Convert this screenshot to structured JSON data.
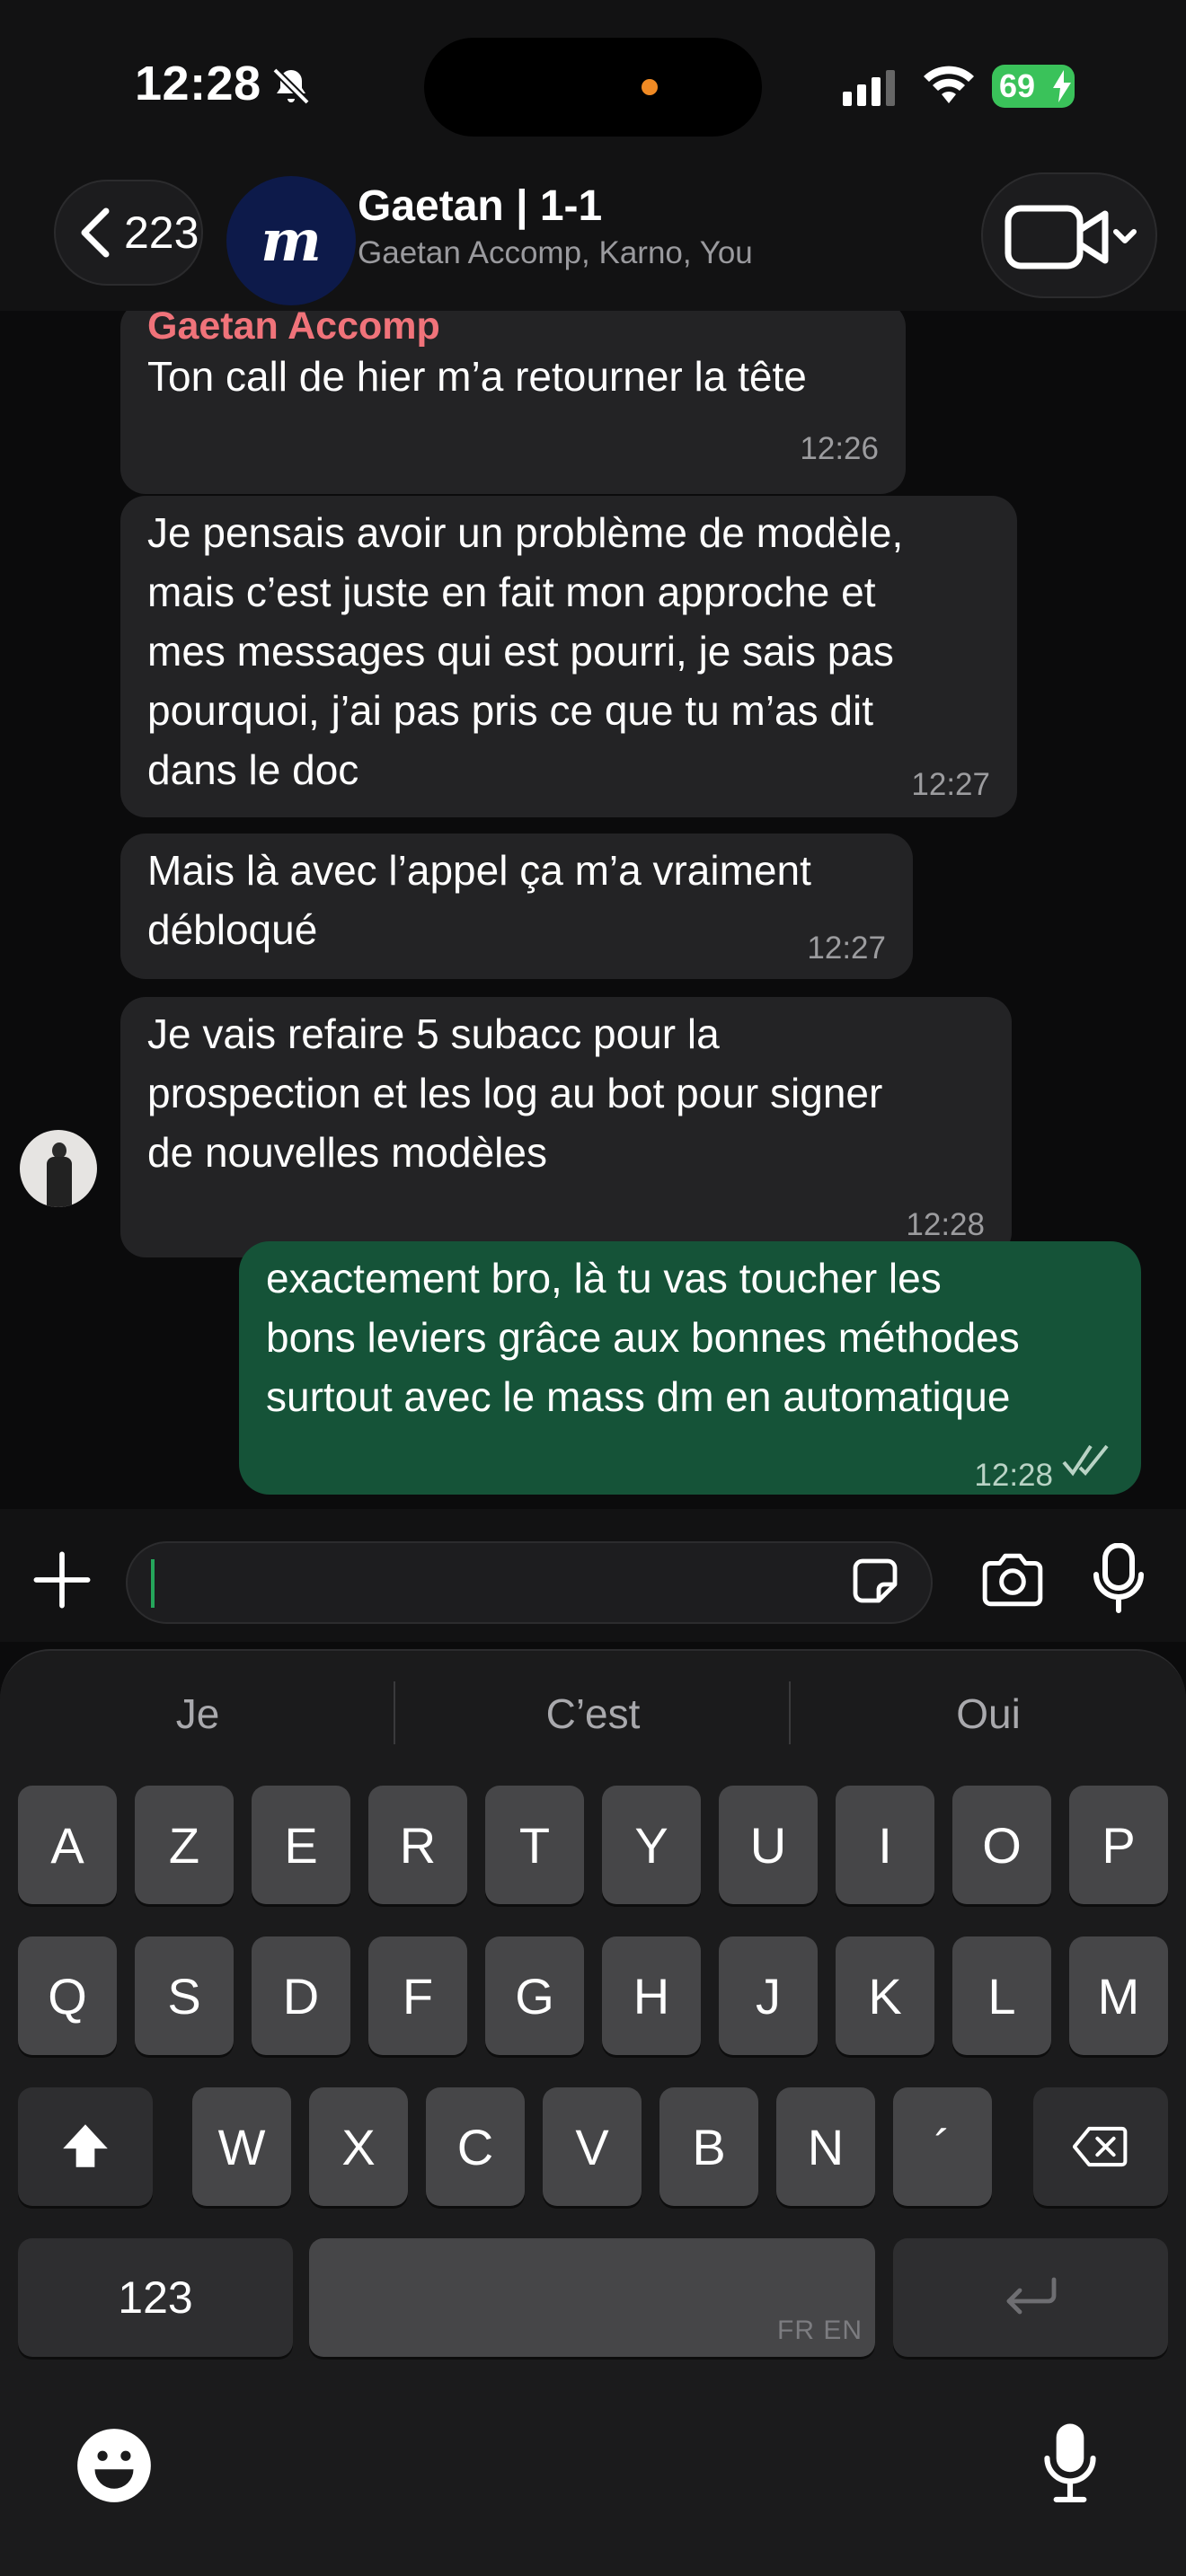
{
  "status_bar": {
    "time": "12:28",
    "battery": "69"
  },
  "header": {
    "back_count": "223",
    "avatar_letter": "m",
    "title": "Gaetan | 1-1",
    "subtitle": "Gaetan Accomp, Karno, You"
  },
  "messages": [
    {
      "sender": "Gaetan Accomp",
      "lines": [
        "Ton call de hier m’a retourner la tête"
      ],
      "time": "12:26"
    },
    {
      "lines": [
        "Je pensais avoir un problème de modèle,",
        "mais c’est juste en fait mon approche et",
        "mes messages qui est pourri, je sais pas",
        "pourquoi, j’ai pas pris ce que tu m’as dit",
        "dans le doc"
      ],
      "time": "12:27"
    },
    {
      "lines": [
        "Mais là avec l’appel ça m’a vraiment",
        "débloqué"
      ],
      "time": "12:27"
    },
    {
      "lines": [
        "Je vais refaire 5 subacc pour la",
        "prospection et les log au bot pour signer",
        "de nouvelles modèles"
      ],
      "time": "12:28"
    }
  ],
  "outgoing": {
    "lines": [
      "exactement bro, là tu vas toucher les",
      "bons leviers grâce aux bonnes méthodes",
      "surtout avec le mass dm en automatique"
    ],
    "time": "12:28"
  },
  "composer": {
    "value": ""
  },
  "keyboard": {
    "suggestions": [
      "Je",
      "C’est",
      "Oui"
    ],
    "row1": [
      "A",
      "Z",
      "E",
      "R",
      "T",
      "Y",
      "U",
      "I",
      "O",
      "P"
    ],
    "row2": [
      "Q",
      "S",
      "D",
      "F",
      "G",
      "H",
      "J",
      "K",
      "L",
      "M"
    ],
    "row3": [
      "W",
      "X",
      "C",
      "V",
      "B",
      "N",
      "´"
    ],
    "numbers_label": "123",
    "space_lang": "FR EN"
  },
  "colors": {
    "outgoing_bubble": "#155338",
    "sender_name": "#f0737a",
    "battery": "#3ac25a"
  }
}
